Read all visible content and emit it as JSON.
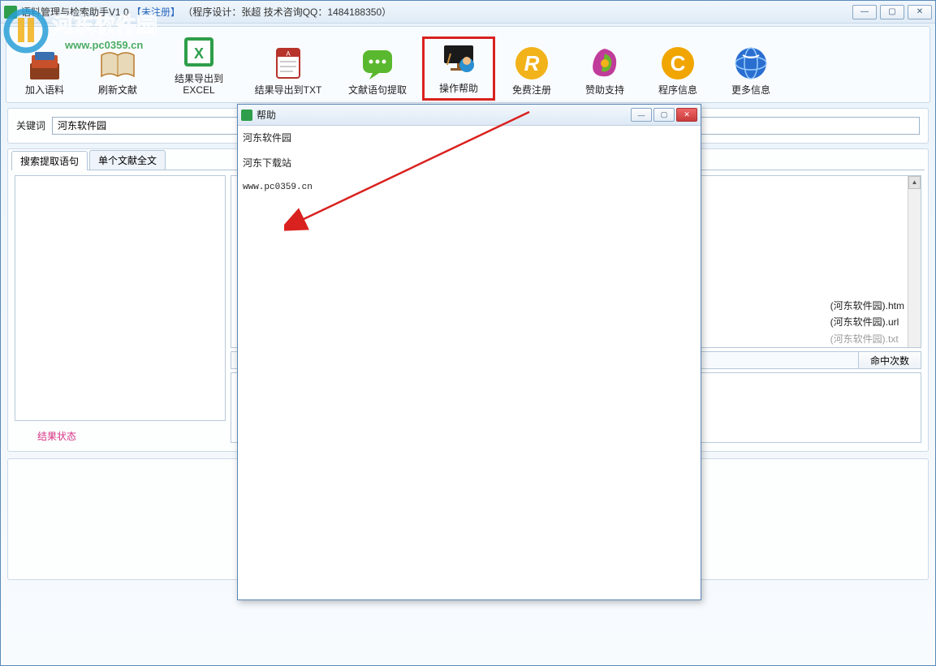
{
  "window": {
    "title_prefix": "语料管理与检索助手V1.0",
    "title_unreg": "【未注册】",
    "title_suffix": "（程序设计：张超  技术咨询QQ：1484188350）"
  },
  "win_controls": {
    "min": "—",
    "max": "▢",
    "close": "✕"
  },
  "toolbar": {
    "items": [
      {
        "label": "加入语料"
      },
      {
        "label": "刷新文献"
      },
      {
        "label": "结果导出到\nEXCEL"
      },
      {
        "label": "结果导出到TXT"
      },
      {
        "label": "文献语句提取"
      },
      {
        "label": "操作帮助"
      },
      {
        "label": "免费注册"
      },
      {
        "label": "赞助支持"
      },
      {
        "label": "程序信息"
      },
      {
        "label": "更多信息"
      }
    ]
  },
  "keyword": {
    "label": "关键词",
    "value": "河东软件园"
  },
  "tabs": {
    "tab1": "搜索提取语句",
    "tab2": "单个文献全文"
  },
  "status_label": "结果状态",
  "file_lines": {
    "l1": "(河东软件园).htm",
    "l2": "(河东软件园).url",
    "l3": "(河东软件园).txt"
  },
  "hit_count_label": "命中次数",
  "help": {
    "title": "帮助",
    "line1": "河东软件园",
    "line2": "河东下载站",
    "url": "www.pc0359.cn"
  },
  "watermark": {
    "line1": "河东软件园",
    "line2": "www.pc0359.cn"
  },
  "icon_colors": {
    "tool0": "#3a6fb0",
    "tool1": "#b87a2a",
    "tool2": "#2e9e4a",
    "tool3": "#b7342b",
    "tool4": "#5ab82e",
    "tool5": "#2a6fb8",
    "tool6": "#f2b21a",
    "tool7": "#c03c9a",
    "tool8": "#f0a500",
    "tool9": "#2a6fd0"
  }
}
